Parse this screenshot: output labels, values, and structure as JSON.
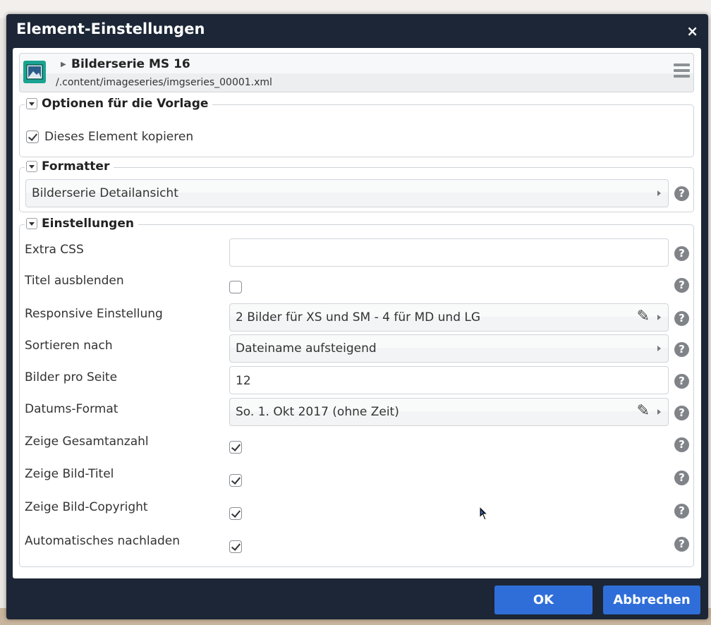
{
  "dialog": {
    "title": "Element-Einstellungen",
    "close_label": "×"
  },
  "resource": {
    "title": "Bilderserie MS 16",
    "path": "/.content/imageseries/imgseries_00001.xml",
    "icon": "image-gallery-icon"
  },
  "template_options": {
    "legend": "Optionen für die Vorlage",
    "copy_element": {
      "label": "Dieses Element kopieren",
      "checked": true
    }
  },
  "formatter": {
    "legend": "Formatter",
    "value": "Bilderserie Detailansicht"
  },
  "settings": {
    "legend": "Einstellungen",
    "extra_css": {
      "label": "Extra CSS",
      "value": ""
    },
    "hide_title": {
      "label": "Titel ausblenden",
      "checked": false
    },
    "responsive": {
      "label": "Responsive Einstellung",
      "value": "2 Bilder für XS und SM - 4 für MD und LG"
    },
    "sort_by": {
      "label": "Sortieren nach",
      "value": "Dateiname aufsteigend"
    },
    "per_page": {
      "label": "Bilder pro Seite",
      "value": "12"
    },
    "date_format": {
      "label": "Datums-Format",
      "value": "So. 1. Okt 2017 (ohne Zeit)"
    },
    "show_count": {
      "label": "Zeige Gesamtanzahl",
      "checked": true
    },
    "show_title": {
      "label": "Zeige Bild-Titel",
      "checked": true
    },
    "show_copyright": {
      "label": "Zeige Bild-Copyright",
      "checked": true
    },
    "autoload": {
      "label": "Automatisches nachladen",
      "checked": true
    }
  },
  "help_glyph": "?",
  "footer": {
    "ok_label": "OK",
    "cancel_label": "Abbrechen"
  },
  "colors": {
    "dialog_bg": "#1c2636",
    "button_blue": "#2f6ed9",
    "icon_teal": "#1aa392"
  }
}
